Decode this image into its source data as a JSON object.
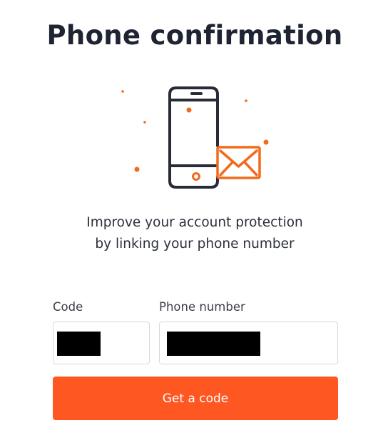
{
  "page": {
    "title": "Phone confirmation",
    "description_line1": "Improve your account protection",
    "description_line2": "by linking your phone number"
  },
  "form": {
    "code_label": "Code",
    "phone_label": "Phone number",
    "code_value": "",
    "phone_value": "",
    "submit_label": "Get a code"
  },
  "illustration": {
    "icons": [
      "smartphone-icon",
      "envelope-icon"
    ]
  },
  "colors": {
    "accent": "#ff5722",
    "text_dark": "#1f2433",
    "border": "#d8d9dc"
  }
}
